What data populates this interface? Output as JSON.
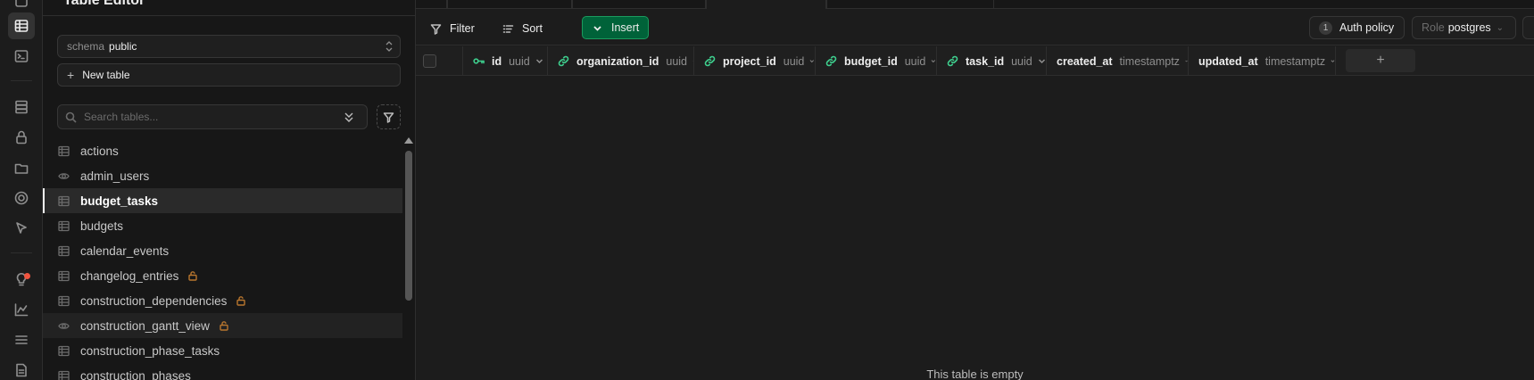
{
  "app": {
    "sidebar_title": "Table Editor"
  },
  "rail": {
    "icons": [
      "table-editor-icon",
      "sql-editor-icon",
      "database-icon",
      "auth-icon",
      "storage-icon",
      "edge-functions-icon",
      "realtime-icon",
      "advisors-icon",
      "reports-icon",
      "logs-icon",
      "api-docs-icon"
    ]
  },
  "sidebar": {
    "schema_label": "schema",
    "schema_value": "public",
    "new_table_label": "New table",
    "search_placeholder": "Search tables...",
    "tables": [
      {
        "name": "actions",
        "kind": "table",
        "locked": false,
        "selected": false
      },
      {
        "name": "admin_users",
        "kind": "view",
        "locked": false,
        "selected": false
      },
      {
        "name": "budget_tasks",
        "kind": "table",
        "locked": false,
        "selected": true
      },
      {
        "name": "budgets",
        "kind": "table",
        "locked": false,
        "selected": false
      },
      {
        "name": "calendar_events",
        "kind": "table",
        "locked": false,
        "selected": false
      },
      {
        "name": "changelog_entries",
        "kind": "table",
        "locked": true,
        "selected": false
      },
      {
        "name": "construction_dependencies",
        "kind": "table",
        "locked": true,
        "selected": false
      },
      {
        "name": "construction_gantt_view",
        "kind": "view",
        "locked": true,
        "selected": false
      },
      {
        "name": "construction_phase_tasks",
        "kind": "table",
        "locked": false,
        "selected": false
      },
      {
        "name": "construction_phases",
        "kind": "table",
        "locked": false,
        "selected": false
      }
    ]
  },
  "toolbar": {
    "filter_label": "Filter",
    "sort_label": "Sort",
    "insert_label": "Insert",
    "auth_policy_count": "1",
    "auth_policy_label": "Auth policy",
    "role_label": "Role",
    "role_value": "postgres"
  },
  "grid": {
    "columns": [
      {
        "name": "id",
        "type": "uuid",
        "icon": "primary-key-icon"
      },
      {
        "name": "organization_id",
        "type": "uuid",
        "icon": "foreign-key-link-icon"
      },
      {
        "name": "project_id",
        "type": "uuid",
        "icon": "foreign-key-link-icon"
      },
      {
        "name": "budget_id",
        "type": "uuid",
        "icon": "foreign-key-link-icon"
      },
      {
        "name": "task_id",
        "type": "uuid",
        "icon": "foreign-key-link-icon"
      },
      {
        "name": "created_at",
        "type": "timestamptz",
        "icon": ""
      },
      {
        "name": "updated_at",
        "type": "timestamptz",
        "icon": ""
      }
    ],
    "add_column_label": "+",
    "empty_message": "This table is empty"
  },
  "colors": {
    "accent_green": "#3ecf8e",
    "insert_bg": "#006239",
    "lock_orange": "#b8762e",
    "notification_red": "#f0543f"
  }
}
